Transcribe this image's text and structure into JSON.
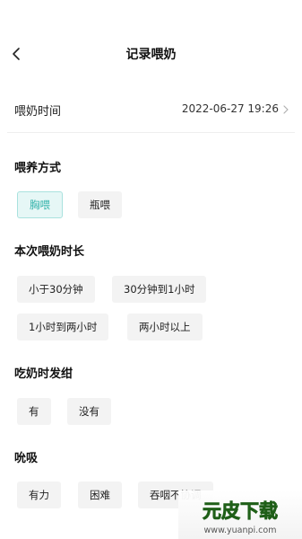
{
  "header": {
    "title": "记录喂奶"
  },
  "time": {
    "label": "喂奶时间",
    "value": "2022-06-27 19:26"
  },
  "feeding_method": {
    "title": "喂养方式",
    "options": [
      "胸喂",
      "瓶喂"
    ],
    "selected": "胸喂"
  },
  "duration": {
    "title": "本次喂奶时长",
    "options": [
      "小于30分钟",
      "30分钟到1小时",
      "1小时到两小时",
      "两小时以上"
    ]
  },
  "cyanosis": {
    "title": "吃奶时发绀",
    "options": [
      "有",
      "没有"
    ]
  },
  "sucking": {
    "title": "吮吸",
    "options": [
      "有力",
      "困难",
      "吞咽不协调"
    ]
  },
  "watermark": {
    "brand": "元皮下载",
    "url": "www.yuanpi.com"
  },
  "colors": {
    "accent": "#34b3ab",
    "accent_bg": "#e6f7f6",
    "option_bg": "#f3f3f3"
  }
}
